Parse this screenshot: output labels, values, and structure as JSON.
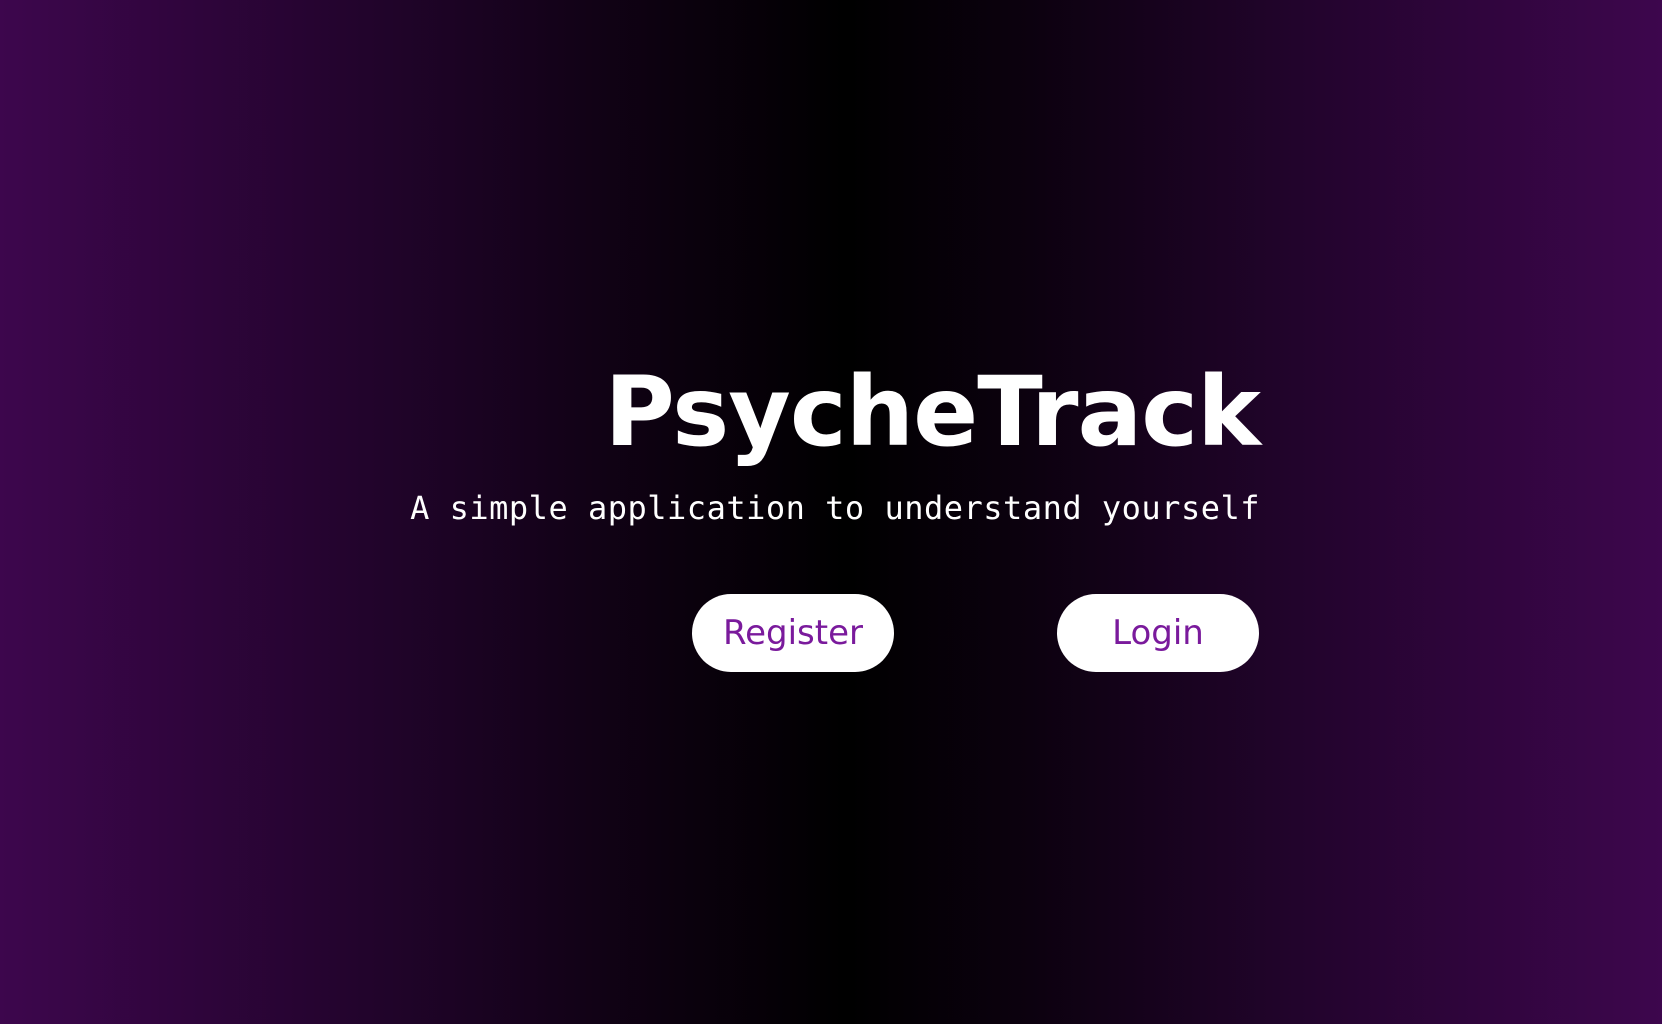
{
  "app": {
    "title": "PsycheTrack",
    "tagline": "A simple application to understand yourself"
  },
  "actions": {
    "register_label": "Register",
    "login_label": "Login"
  },
  "colors": {
    "background_edge": "#3d064d",
    "background_center": "#000000",
    "text": "#ffffff",
    "button_bg": "#ffffff",
    "button_text": "#7a1a9c"
  }
}
